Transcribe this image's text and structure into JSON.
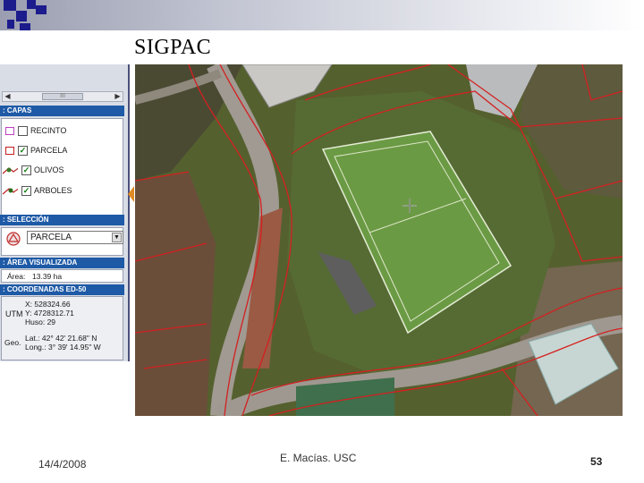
{
  "slide": {
    "title": "SIGPAC",
    "date": "14/4/2008",
    "author": "E. Macías. USC",
    "page_number": "53"
  },
  "app": {
    "scroll_label": "III",
    "capas": {
      "header": ": CAPAS",
      "layers": [
        {
          "label": "RECINTO",
          "checked": false
        },
        {
          "label": "PARCELA",
          "checked": true
        },
        {
          "label": "OLIVOS",
          "checked": true
        },
        {
          "label": "ARBOLES",
          "checked": true
        }
      ]
    },
    "seleccion": {
      "header": ": SELECCIÓN",
      "value": "PARCELA"
    },
    "area": {
      "header": ": ÁREA VISUALIZADA",
      "label": "Área:",
      "value": "13.39 ha"
    },
    "coords": {
      "header": ": COORDENADAS ED-50",
      "utm_label": "UTM",
      "x": "X: 528324.66",
      "y": "Y: 4728312.71",
      "huso": "Huso: 29",
      "geo_label": "Geo.",
      "lat": "Lat.: 42° 42' 21.68\" N",
      "long": "Long.: 3° 39' 14.95\" W"
    }
  },
  "colors": {
    "header_blue": "#1e5aa6",
    "parcel_line": "#d42020",
    "pitch_green": "#5a8a3a"
  }
}
